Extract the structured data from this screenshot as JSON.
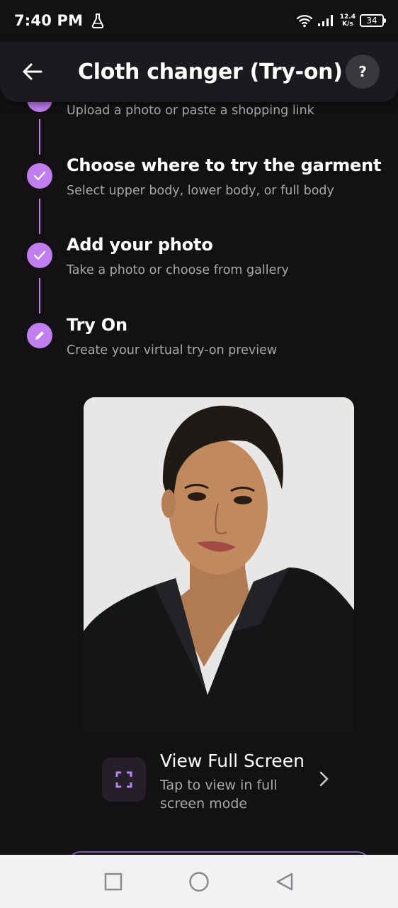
{
  "status_bar": {
    "time": "7:40 PM",
    "speed_value": "12.4",
    "speed_unit": "K/s",
    "battery": "34"
  },
  "app_bar": {
    "title": "Cloth changer (Try-on)",
    "help_label": "?"
  },
  "steps": [
    {
      "title": "",
      "subtitle": "Upload a photo or paste a shopping link",
      "state": "done"
    },
    {
      "title": "Choose where to try the garment",
      "subtitle": "Select upper body, lower body, or full body",
      "state": "done"
    },
    {
      "title": "Add your photo",
      "subtitle": "Take a photo or choose from gallery",
      "state": "done"
    },
    {
      "title": "Try On",
      "subtitle": "Create your virtual try-on preview",
      "state": "active"
    }
  ],
  "view_full_screen": {
    "title": "View Full Screen",
    "subtitle": "Tap to view in full screen mode"
  },
  "colors": {
    "accent": "#c07ef0",
    "background": "#131113",
    "app_bar": "#1c1a1f"
  }
}
